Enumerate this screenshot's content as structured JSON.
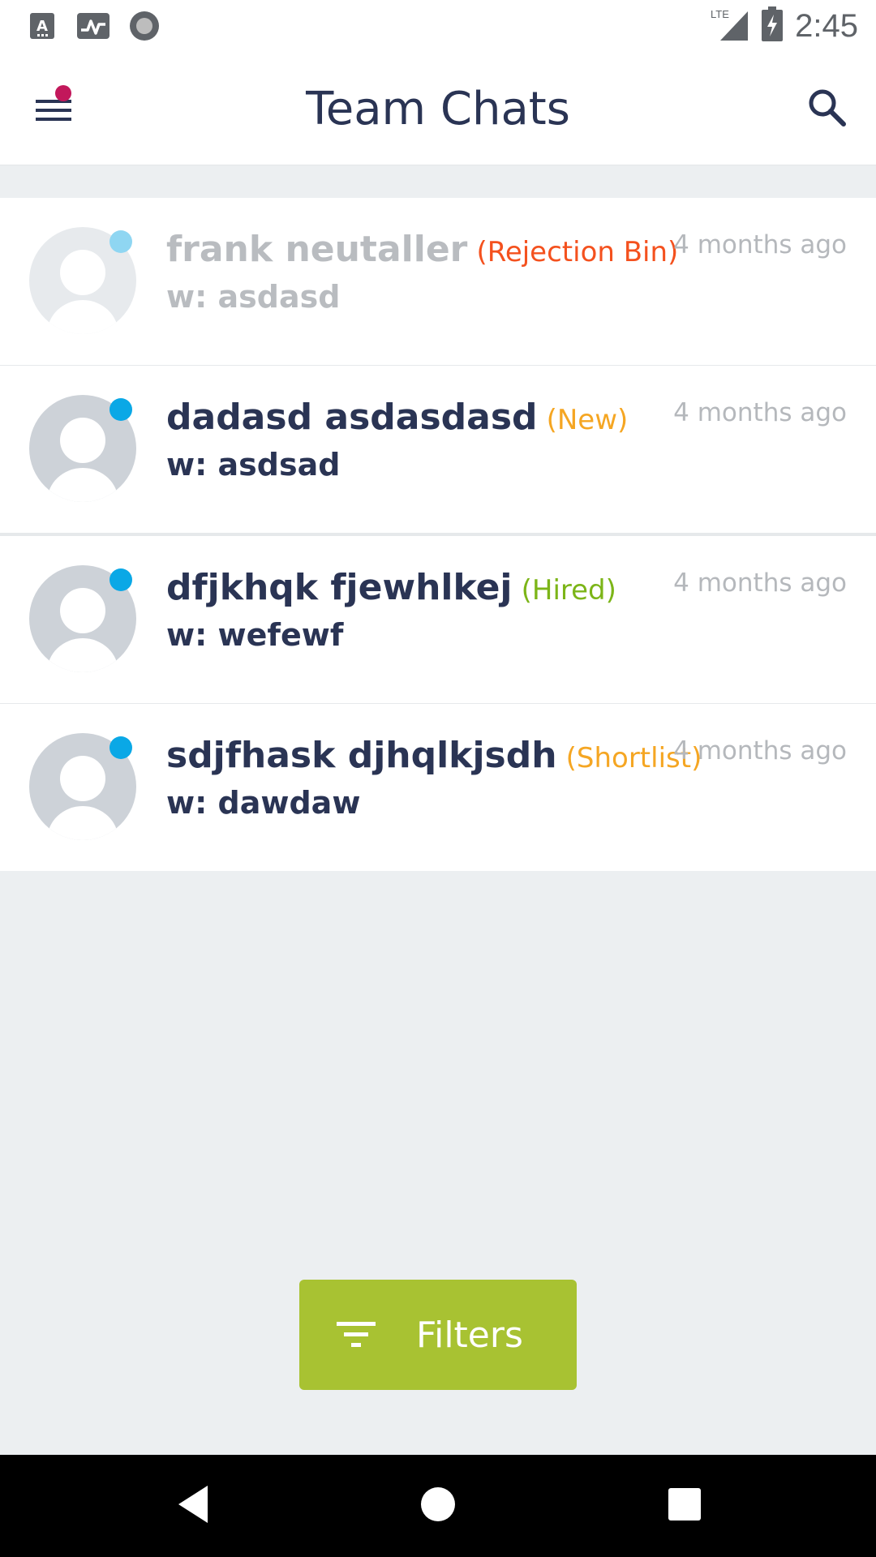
{
  "status_bar": {
    "time": "2:45",
    "network": "LTE",
    "left_icons": [
      "text-recognition-icon",
      "activity-pulse-icon",
      "record-circle-icon"
    ],
    "right_icons": [
      "lte-signal-icon",
      "battery-charging-icon"
    ]
  },
  "header": {
    "title": "Team Chats",
    "menu_icon": "hamburger-menu-icon",
    "notification_dot_color": "#c2185b",
    "search_icon": "search-icon"
  },
  "chats": [
    {
      "name": "frank neutaller",
      "status": "(Rejection Bin)",
      "status_color": "#f4511e",
      "subtitle": "w: asdasd",
      "time": "4 months ago",
      "muted": true
    },
    {
      "name": "dadasd asdasdasd",
      "status": "(New)",
      "status_color": "#f5a623",
      "subtitle": "w: asdsad",
      "time": "4 months ago",
      "muted": false
    },
    {
      "name": "dfjkhqk fjewhlkej",
      "status": "(Hired)",
      "status_color": "#7cb518",
      "subtitle": "w: wefewf",
      "time": "4 months ago",
      "muted": false
    },
    {
      "name": "sdjfhask djhqlkjsdh",
      "status": "(Shortlist)",
      "status_color": "#f5a623",
      "subtitle": "w: dawdaw",
      "time": "4 months ago",
      "muted": false
    }
  ],
  "filters_button": {
    "label": "Filters",
    "icon": "filter-list-icon",
    "color": "#a8c232"
  },
  "nav_bar": {
    "icons": [
      "back-icon",
      "home-icon",
      "recents-icon"
    ]
  }
}
